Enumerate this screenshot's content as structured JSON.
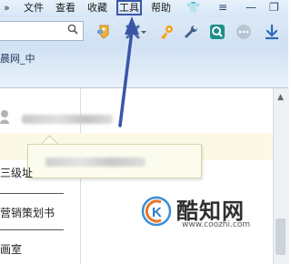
{
  "menubar": {
    "back_glyph": "»",
    "items": [
      "文件",
      "查看",
      "收藏",
      "工具",
      "帮助"
    ],
    "window_buttons": [
      "👕",
      "≡",
      "—",
      "❐"
    ]
  },
  "address": {
    "search_icon": "search-icon"
  },
  "toolbar": {
    "icons": [
      "tag-icon",
      "tools-x-icon",
      "dropdown-arrow-icon",
      "key-icon",
      "wrench-icon",
      "magnifier-icon",
      "more-icon",
      "download-icon"
    ]
  },
  "favorites": {
    "item_label": "晨网_中"
  },
  "sidebar": {
    "items": [
      "三级址",
      "营销策划书",
      "画室"
    ]
  },
  "watermark": {
    "name": "酷知网",
    "url": "www.coozhi.com"
  },
  "annotation": {
    "color": "#3a55a8"
  }
}
